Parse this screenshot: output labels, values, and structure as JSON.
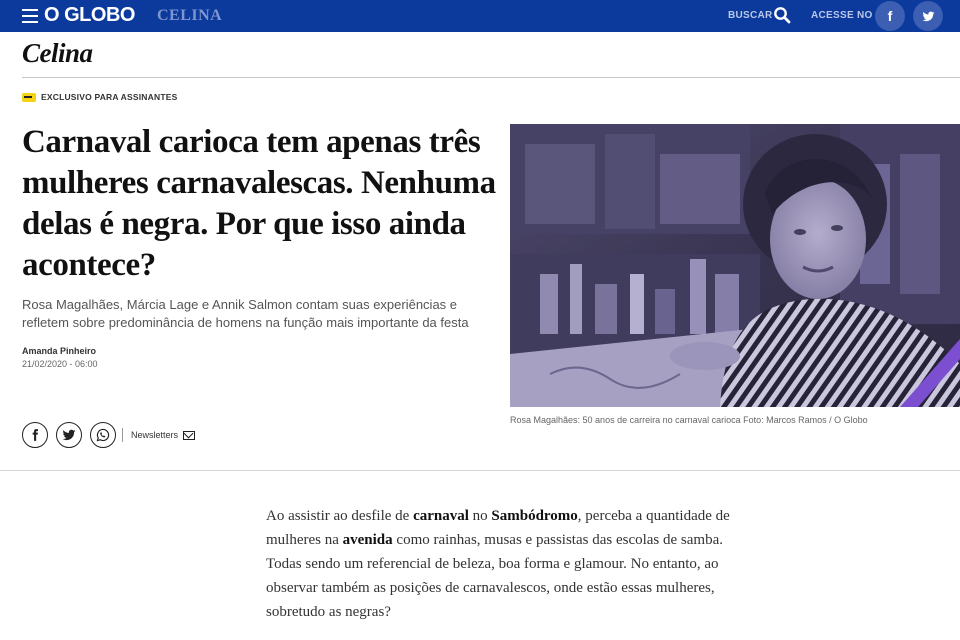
{
  "topbar": {
    "logo": "O GLOBO",
    "section": "CELINA",
    "search_label": "BUSCAR",
    "login_label": "ACESSE NO",
    "facebook_glyph": "f"
  },
  "celina_logo": "Celina",
  "badge": "EXCLUSIVO PARA ASSINANTES",
  "article": {
    "headline": "Carnaval carioca tem apenas três mulheres carnavalescas. Nenhuma delas é negra. Por que isso ainda acontece?",
    "subtitle": "Rosa Magalhães, Márcia Lage e Annik Salmon contam suas experiências e refletem sobre predominância de homens na função mais importante da festa",
    "author": "Amanda Pinheiro",
    "date": "21/02/2020 - 06:00",
    "caption": "Rosa Magalhães: 50 anos de carreira no carnaval carioca Foto: Marcos Ramos / O Globo"
  },
  "share": {
    "newsletters_label": "Newsletters"
  },
  "body": {
    "p1_a": "Ao assistir ao desfile de ",
    "p1_b": "carnaval",
    "p1_c": " no ",
    "p1_d": "Sambódromo",
    "p1_e": ", perceba a quantidade de mulheres na ",
    "p1_f": "avenida",
    "p1_g": " como rainhas, musas e passistas das escolas de samba. Todas sendo um referencial de beleza, boa forma e glamour. No entanto, ao observar também as posições de carnavalescos, onde estão essas mulheres, sobretudo as negras?"
  },
  "colors": {
    "topbar": "#0b3a9c",
    "badge_key": "#f5d314",
    "photo_tint": "#6a5fa8",
    "photo_stripe": "#7c4fd0"
  },
  "icons": [
    "menu-icon",
    "search-icon",
    "facebook-icon",
    "twitter-icon",
    "whatsapp-icon",
    "mail-icon",
    "key-icon"
  ]
}
